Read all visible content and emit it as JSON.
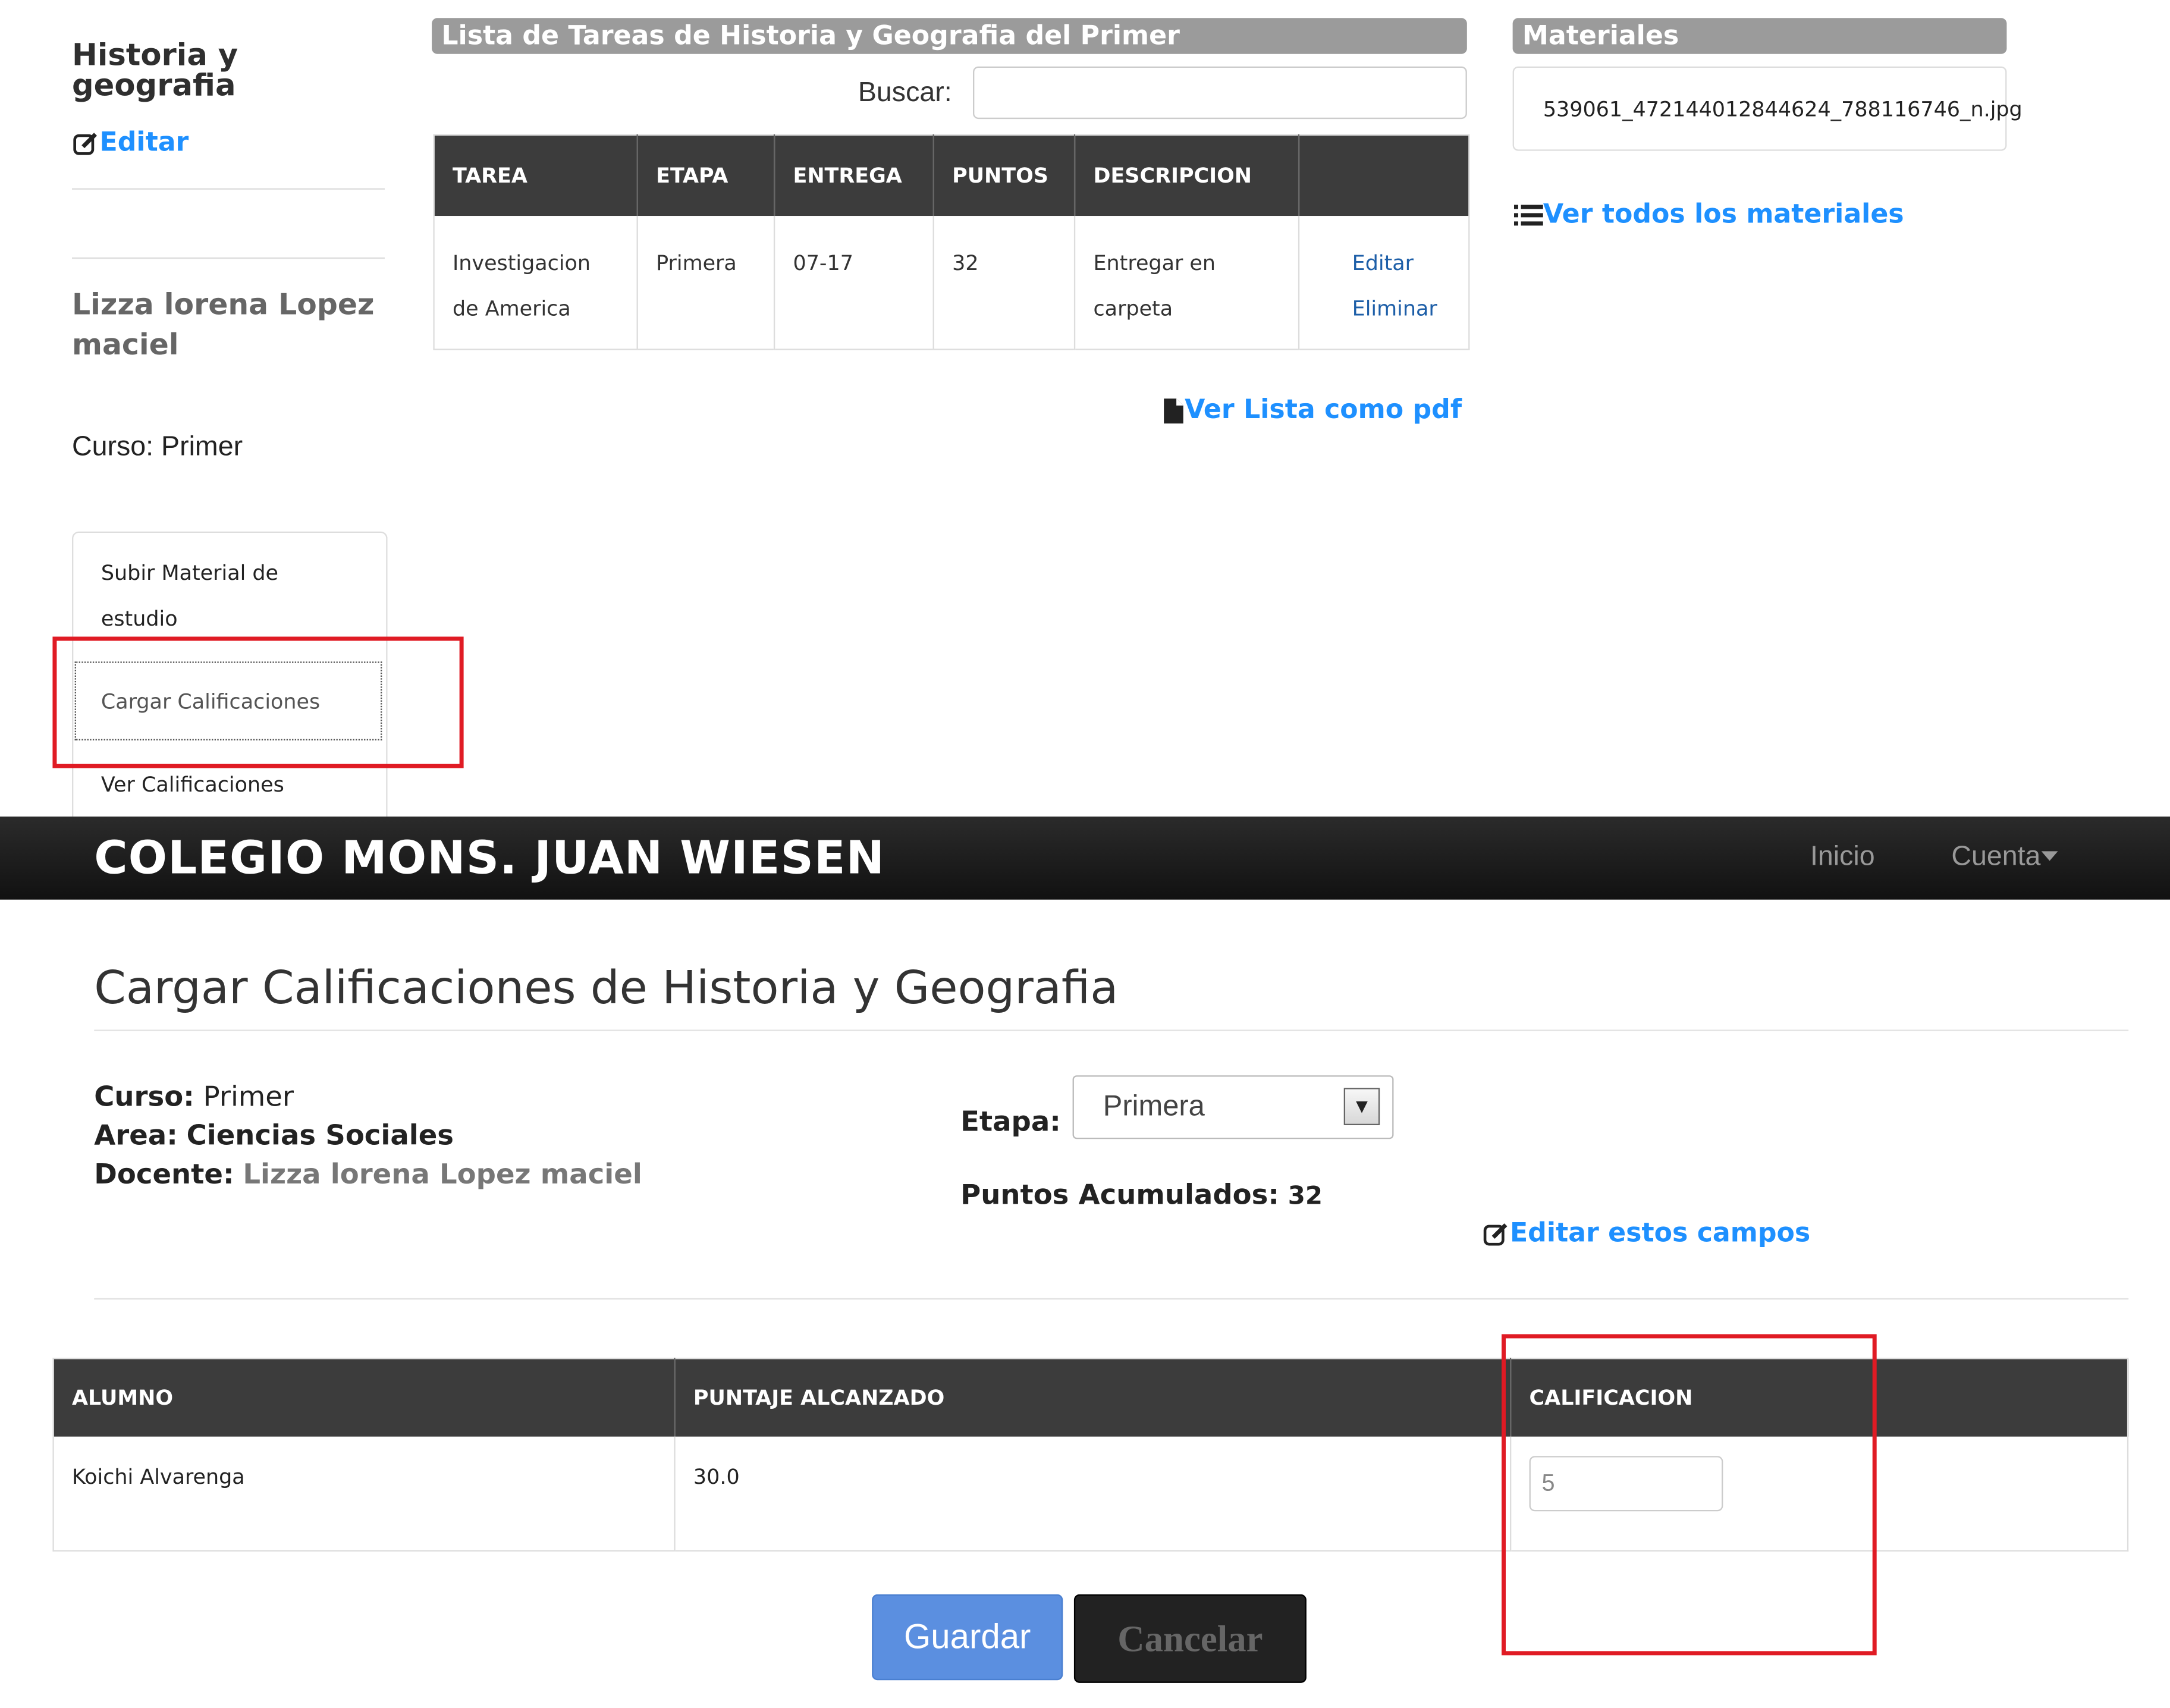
{
  "top": {
    "subject_title": "Historia y geografia",
    "edit_label": "Editar",
    "teacher_name": "Lizza lorena Lopez maciel",
    "curso_label": "Curso:",
    "curso_value": "Primer",
    "side_menu": {
      "upload_material": "Subir Material de estudio",
      "load_grades": "Cargar Calificaciones",
      "view_grades": "Ver Calificaciones"
    },
    "task_list_title": "Lista de Tareas de Historia y Geografia del Primer",
    "search_label": "Buscar:",
    "search_value": "",
    "task_table": {
      "headers": [
        "TAREA",
        "ETAPA",
        "ENTREGA",
        "PUNTOS",
        "DESCRIPCION",
        ""
      ],
      "rows": [
        {
          "tarea": "Investigacion de America",
          "etapa": "Primera",
          "entrega": "07-17",
          "puntos": "32",
          "descripcion": "Entregar en carpeta",
          "edit": "Editar",
          "delete": "Eliminar"
        }
      ]
    },
    "pdf_link": "Ver Lista como pdf",
    "materials_title": "Materiales",
    "material_file": "539061_472144012844624_788116746_n.jpg",
    "all_materials_link": "Ver todos los materiales"
  },
  "navbar": {
    "brand": "COLEGIO MONS. JUAN WIESEN",
    "items": [
      "Inicio",
      "Cuenta"
    ]
  },
  "main": {
    "title": "Cargar Calificaciones de Historia y Geografia",
    "curso_label": "Curso:",
    "curso_value": "Primer",
    "area_label": "Area:",
    "area_value": "Ciencias Sociales",
    "docente_label": "Docente:",
    "docente_value": "Lizza lorena Lopez maciel",
    "etapa_label": "Etapa:",
    "etapa_value": "Primera",
    "puntos_label": "Puntos Acumulados:",
    "puntos_value": "32",
    "edit_fields_link": "Editar estos campos",
    "grades_table": {
      "headers": [
        "ALUMNO",
        "PUNTAJE ALCANZADO",
        "CALIFICACION"
      ],
      "rows": [
        {
          "alumno": "Koichi Alvarenga",
          "puntaje": "30.0",
          "calificacion": "5"
        }
      ]
    },
    "save_button": "Guardar",
    "cancel_button": "Cancelar"
  },
  "colors": {
    "link": "#1e90ff",
    "highlight": "#e01b24",
    "table_header": "#3c3c3c",
    "save_button": "#5b8fe0"
  },
  "icons": [
    "edit-icon",
    "document-icon",
    "list-icon",
    "caret-down-icon"
  ]
}
